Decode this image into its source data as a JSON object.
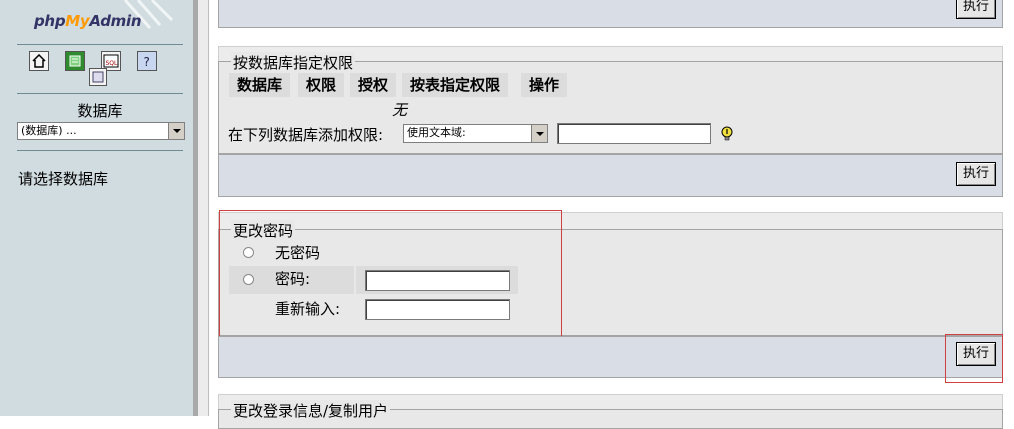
{
  "sidebar": {
    "logo_prefix": "php",
    "logo_my": "My",
    "logo_suffix": "Admin",
    "db_label": "数据库",
    "db_select_value": "(数据库) ...",
    "choose_db_text": "请选择数据库",
    "icons": [
      "home-icon",
      "sql-query-icon",
      "sql-window-icon",
      "help-icon",
      "docs-icon"
    ]
  },
  "main": {
    "top_execute": "执行",
    "db_privs": {
      "legend": "按数据库指定权限",
      "headers": [
        "数据库",
        "权限",
        "授权",
        "按表指定权限",
        "操作"
      ],
      "empty": "无",
      "add_label": "在下列数据库添加权限:",
      "add_select": "使用文本域:",
      "execute": "执行"
    },
    "change_password": {
      "legend": "更改密码",
      "no_password": "无密码",
      "password": "密码:",
      "reenter": "重新输入:",
      "execute": "执行"
    },
    "login_info_legend": "更改登录信息/复制用户"
  }
}
